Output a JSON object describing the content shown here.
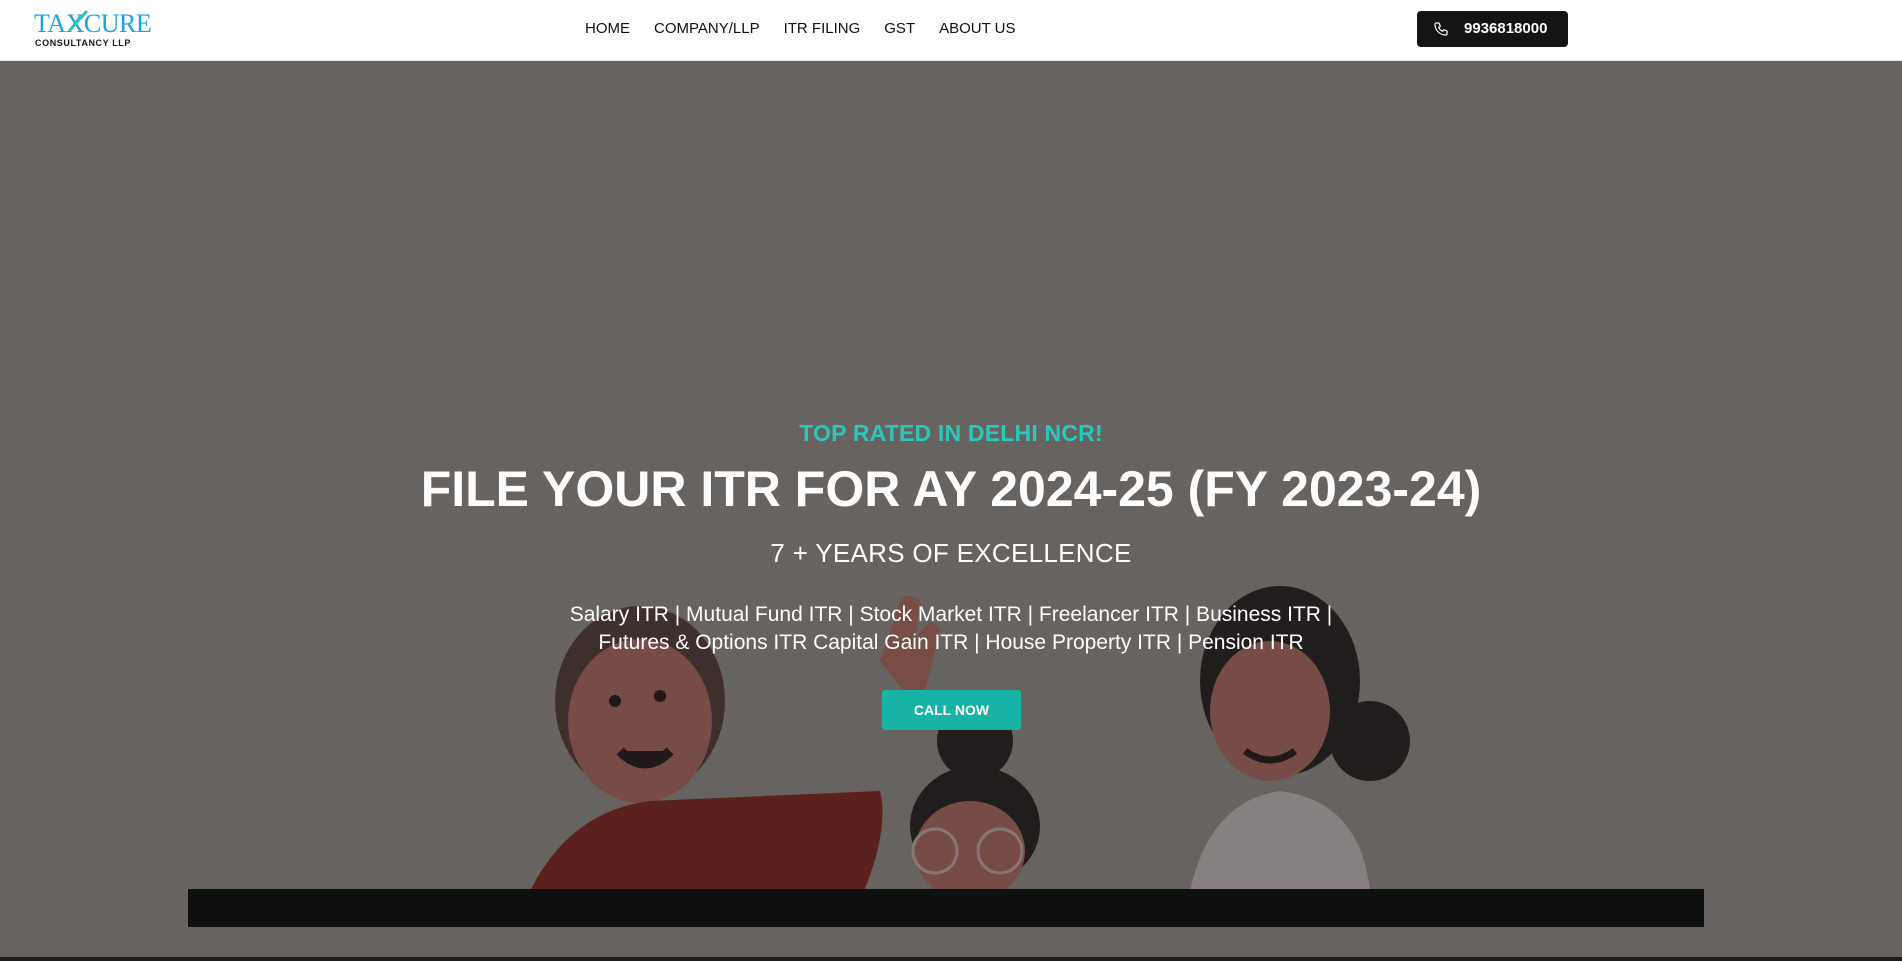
{
  "brand": {
    "logo_main": "TAXCURE",
    "logo_sub": "CONSULTANCY LLP"
  },
  "nav": {
    "items": [
      {
        "label": "HOME"
      },
      {
        "label": "COMPANY/LLP"
      },
      {
        "label": "ITR FILING"
      },
      {
        "label": "GST"
      },
      {
        "label": "ABOUT US"
      }
    ]
  },
  "contact": {
    "phone": "9936818000",
    "icon": "phone-icon"
  },
  "hero": {
    "eyebrow": "TOP RATED IN DELHI NCR!",
    "headline": "FILE YOUR ITR FOR AY 2024-25 (FY 2023-24)",
    "subhead": "7 + YEARS OF EXCELLENCE",
    "services_line1": "Salary ITR | Mutual Fund ITR | Stock Market ITR | Freelancer ITR | Business ITR |",
    "services_line2": "Futures & Options ITR Capital Gain ITR | House Property ITR | Pension ITR",
    "cta_label": "CALL NOW"
  },
  "colors": {
    "accent": "#17b3a6",
    "eyebrow": "#2cc7bb",
    "overlay": "#676360",
    "logo_blue": "#1aa3dc"
  }
}
